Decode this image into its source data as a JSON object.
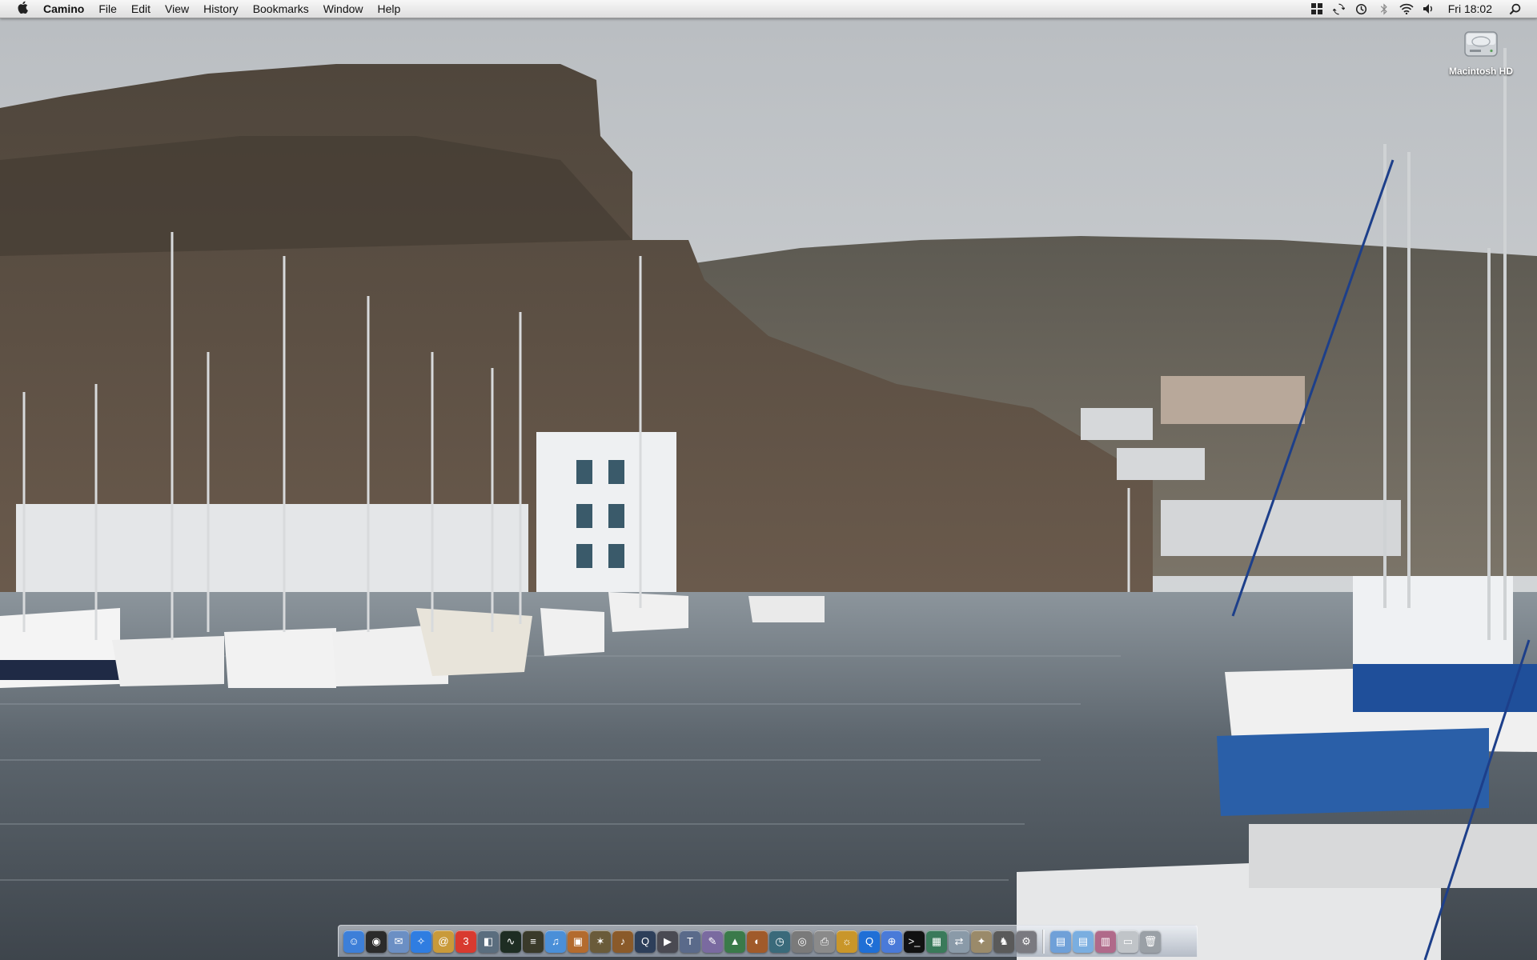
{
  "menubar": {
    "apple_icon": "apple-icon",
    "app_name": "Camino",
    "menus": [
      "File",
      "Edit",
      "View",
      "History",
      "Bookmarks",
      "Window",
      "Help"
    ],
    "status_icons": [
      "spaces-icon",
      "sync-icon",
      "time-machine-icon",
      "bluetooth-icon",
      "wifi-icon",
      "volume-icon"
    ],
    "clock": "Fri 18:02",
    "spotlight_icon": "search-icon"
  },
  "desktop": {
    "icons": [
      {
        "label": "Macintosh HD",
        "icon": "hard-drive-icon"
      }
    ]
  },
  "dock": {
    "items": [
      {
        "name": "finder-icon",
        "color": "#3d7fd8",
        "glyph": "☺"
      },
      {
        "name": "dashboard-icon",
        "color": "#2b2b2b",
        "glyph": "◉"
      },
      {
        "name": "mail-icon",
        "color": "#6b8fc4",
        "glyph": "✉"
      },
      {
        "name": "safari-icon",
        "color": "#2f7de1",
        "glyph": "✧"
      },
      {
        "name": "address-book-icon",
        "color": "#c99a3a",
        "glyph": "@"
      },
      {
        "name": "ical-icon",
        "color": "#d83a2f",
        "glyph": "3"
      },
      {
        "name": "preview-icon",
        "color": "#5a6d7e",
        "glyph": "◧"
      },
      {
        "name": "activity-monitor-icon",
        "color": "#1e2d23",
        "glyph": "∿"
      },
      {
        "name": "console-icon",
        "color": "#3a3a2a",
        "glyph": "≡"
      },
      {
        "name": "itunes-icon",
        "color": "#4a8fd8",
        "glyph": "♫"
      },
      {
        "name": "iphoto-icon",
        "color": "#b36b2e",
        "glyph": "▣"
      },
      {
        "name": "system-utility-icon",
        "color": "#6a5b3a",
        "glyph": "✶"
      },
      {
        "name": "garageband-icon",
        "color": "#8a5a2a",
        "glyph": "♪"
      },
      {
        "name": "quicktime-icon",
        "color": "#2d3f5a",
        "glyph": "Q"
      },
      {
        "name": "imovie-icon",
        "color": "#4a4a52",
        "glyph": "▶"
      },
      {
        "name": "textedit-icon",
        "color": "#5a6a8a",
        "glyph": "T"
      },
      {
        "name": "script-editor-icon",
        "color": "#7a6aa0",
        "glyph": "✎"
      },
      {
        "name": "grapher-icon",
        "color": "#3a7a4a",
        "glyph": "▲"
      },
      {
        "name": "ichat-icon",
        "color": "#a05a2a",
        "glyph": "◐"
      },
      {
        "name": "time-machine-dock-icon",
        "color": "#3a6a7a",
        "glyph": "◷"
      },
      {
        "name": "disk-utility-icon",
        "color": "#7a7a7a",
        "glyph": "◎"
      },
      {
        "name": "printer-icon",
        "color": "#8a8a8a",
        "glyph": "⎙"
      },
      {
        "name": "camino-icon",
        "color": "#c9962a",
        "glyph": "☼"
      },
      {
        "name": "quicksilver-icon",
        "color": "#1f6fd6",
        "glyph": "Q"
      },
      {
        "name": "network-icon",
        "color": "#4a7ad8",
        "glyph": "⊕"
      },
      {
        "name": "terminal-icon",
        "color": "#111111",
        "glyph": ">_"
      },
      {
        "name": "photo-booth-icon",
        "color": "#3a7a5a",
        "glyph": "▦"
      },
      {
        "name": "migration-icon",
        "color": "#8a9aa8",
        "glyph": "⇄"
      },
      {
        "name": "keychain-icon",
        "color": "#9a8a6a",
        "glyph": "✦"
      },
      {
        "name": "chess-icon",
        "color": "#5a5a5a",
        "glyph": "♞"
      },
      {
        "name": "system-preferences-icon",
        "color": "#7a7a80",
        "glyph": "⚙"
      }
    ],
    "right_items": [
      {
        "name": "applications-folder-icon",
        "color": "#6fa0d8",
        "glyph": "▤"
      },
      {
        "name": "documents-folder-icon",
        "color": "#7aaee0",
        "glyph": "▤"
      },
      {
        "name": "downloads-stack-icon",
        "color": "#b06a8a",
        "glyph": "▥"
      },
      {
        "name": "drive-stack-icon",
        "color": "#c0c4c8",
        "glyph": "▭"
      },
      {
        "name": "trash-icon",
        "color": "#9aa0a6",
        "glyph": "🗑"
      }
    ]
  }
}
